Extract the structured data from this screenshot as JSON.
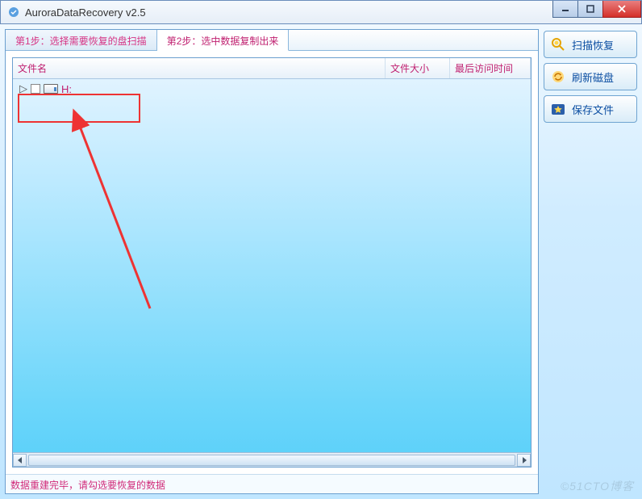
{
  "window": {
    "title": "AuroraDataRecovery v2.5"
  },
  "tabs": [
    {
      "label": "第1步：选择需要恢复的盘扫描",
      "active": false
    },
    {
      "label": "第2步：选中数据复制出来",
      "active": true
    }
  ],
  "columns": {
    "name": "文件名",
    "size": "文件大小",
    "time": "最后访问时间"
  },
  "tree": {
    "root_label": "H:"
  },
  "sidebar": {
    "scan": "扫描恢复",
    "refresh": "刷新磁盘",
    "save": "保存文件"
  },
  "status": "数据重建完毕，请勾选要恢复的数据",
  "watermark": "©51CTO博客"
}
